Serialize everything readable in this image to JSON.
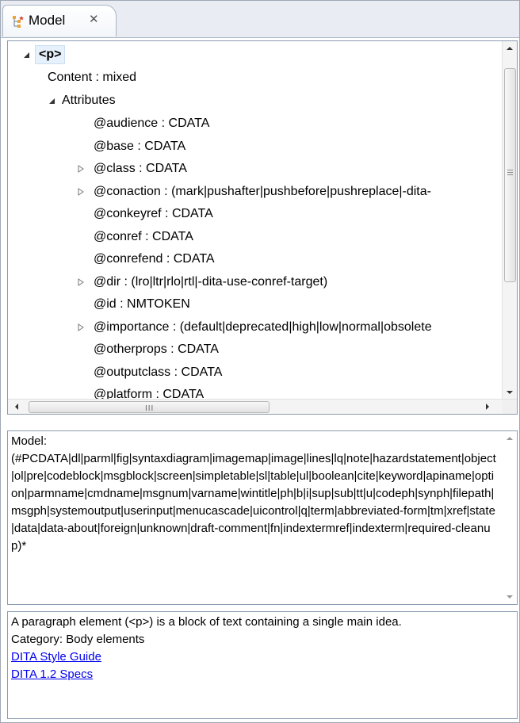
{
  "tab": {
    "title": "Model",
    "icon": "model-tree-icon",
    "close_icon": "close-icon"
  },
  "tree": {
    "root": "<p>",
    "content": "Content : mixed",
    "attributes_label": "Attributes",
    "attributes": [
      {
        "text": "@audience : CDATA",
        "expandable": false
      },
      {
        "text": "@base : CDATA",
        "expandable": false
      },
      {
        "text": "@class : CDATA",
        "expandable": true
      },
      {
        "text": "@conaction : (mark|pushafter|pushbefore|pushreplace|-dita-",
        "expandable": true
      },
      {
        "text": "@conkeyref : CDATA",
        "expandable": false
      },
      {
        "text": "@conref : CDATA",
        "expandable": false
      },
      {
        "text": "@conrefend : CDATA",
        "expandable": false
      },
      {
        "text": "@dir : (lro|ltr|rlo|rtl|-dita-use-conref-target)",
        "expandable": true
      },
      {
        "text": "@id : NMTOKEN",
        "expandable": false
      },
      {
        "text": "@importance : (default|deprecated|high|low|normal|obsolete",
        "expandable": true
      },
      {
        "text": "@otherprops : CDATA",
        "expandable": false
      },
      {
        "text": "@outputclass : CDATA",
        "expandable": false
      },
      {
        "text": "@platform : CDATA",
        "expandable": false
      }
    ],
    "hscroll_grip": "III"
  },
  "model": {
    "label": "Model:",
    "text": "(#PCDATA|dl|parml|fig|syntaxdiagram|imagemap|image|lines|lq|note|hazardstatement|object|ol|pre|codeblock|msgblock|screen|simpletable|sl|table|ul|boolean|cite|keyword|apiname|option|parmname|cmdname|msgnum|varname|wintitle|ph|b|i|sup|sub|tt|u|codeph|synph|filepath|msgph|systemoutput|userinput|menucascade|uicontrol|q|term|abbreviated-form|tm|xref|state|data|data-about|foreign|unknown|draft-comment|fn|indextermref|indexterm|required-cleanup)*"
  },
  "doc": {
    "description": "A paragraph element (<p>) is a block of text containing a single main idea.",
    "category": "Category: Body elements",
    "links": [
      "DITA Style Guide",
      "DITA 1.2 Specs"
    ]
  }
}
